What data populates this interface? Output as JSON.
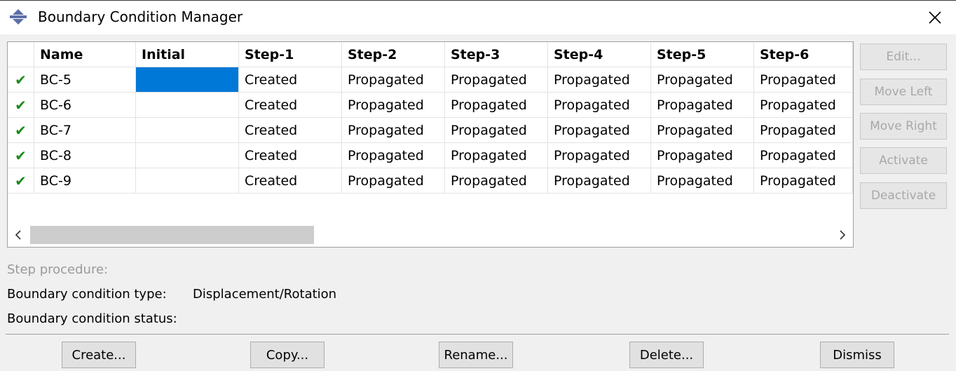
{
  "window": {
    "title": "Boundary Condition Manager"
  },
  "table": {
    "columns": [
      "Name",
      "Initial",
      "Step-1",
      "Step-2",
      "Step-3",
      "Step-4",
      "Step-5",
      "Step-6"
    ],
    "rows": [
      {
        "active": true,
        "cells": [
          "BC-5",
          "",
          "Created",
          "Propagated",
          "Propagated",
          "Propagated",
          "Propagated",
          "Propagated"
        ]
      },
      {
        "active": true,
        "cells": [
          "BC-6",
          "",
          "Created",
          "Propagated",
          "Propagated",
          "Propagated",
          "Propagated",
          "Propagated"
        ]
      },
      {
        "active": true,
        "cells": [
          "BC-7",
          "",
          "Created",
          "Propagated",
          "Propagated",
          "Propagated",
          "Propagated",
          "Propagated"
        ]
      },
      {
        "active": true,
        "cells": [
          "BC-8",
          "",
          "Created",
          "Propagated",
          "Propagated",
          "Propagated",
          "Propagated",
          "Propagated"
        ]
      },
      {
        "active": true,
        "cells": [
          "BC-9",
          "",
          "Created",
          "Propagated",
          "Propagated",
          "Propagated",
          "Propagated",
          "Propagated"
        ]
      }
    ],
    "check_glyph": "✔"
  },
  "side_buttons": {
    "edit": "Edit...",
    "move_left": "Move Left",
    "move_right": "Move Right",
    "activate": "Activate",
    "deactivate": "Deactivate"
  },
  "info": {
    "step_procedure_label": "Step procedure:",
    "bc_type_label": "Boundary condition type:",
    "bc_type_value": "Displacement/Rotation",
    "bc_status_label": "Boundary condition status:"
  },
  "buttons": {
    "create": "Create...",
    "copy": "Copy...",
    "rename": "Rename...",
    "delete": "Delete...",
    "dismiss": "Dismiss"
  },
  "colors": {
    "selection": "#0078d7",
    "check": "#1a8a1a",
    "disabled_text": "#a8a8a8",
    "icon": "#5b6fa8"
  },
  "icons": {
    "title": "abaqus-manager-icon",
    "close": "close-icon"
  }
}
